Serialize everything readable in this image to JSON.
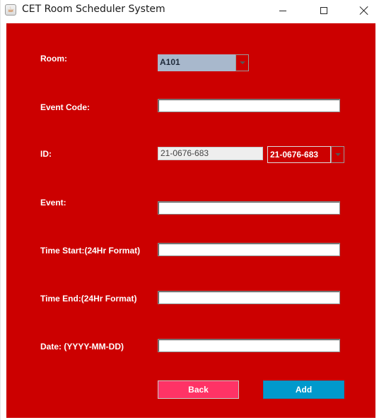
{
  "window": {
    "title": "CET Room Scheduler System",
    "app_icon": "java-cup-icon",
    "controls": [
      "minimize-icon",
      "maximize-icon",
      "close-icon"
    ]
  },
  "colors": {
    "panel_background": "#cc0000",
    "room_combo_background": "#a8b8cc",
    "back_button": "#ff3366",
    "add_button": "#0099cc",
    "label_text": "#ffffff"
  },
  "form": {
    "room": {
      "label": "Room:",
      "selected": "A101"
    },
    "event_code": {
      "label": "Event Code:",
      "value": ""
    },
    "id": {
      "label": "ID:",
      "value": "21-0676-683",
      "selected": "21-0676-683"
    },
    "event": {
      "label": "Event:",
      "value": ""
    },
    "time_start": {
      "label": "Time Start:(24Hr Format)",
      "value": ""
    },
    "time_end": {
      "label": "Time End:(24Hr Format)",
      "value": ""
    },
    "date": {
      "label": "Date: (YYYY-MM-DD)",
      "value": ""
    }
  },
  "buttons": {
    "back": "Back",
    "add": "Add"
  }
}
